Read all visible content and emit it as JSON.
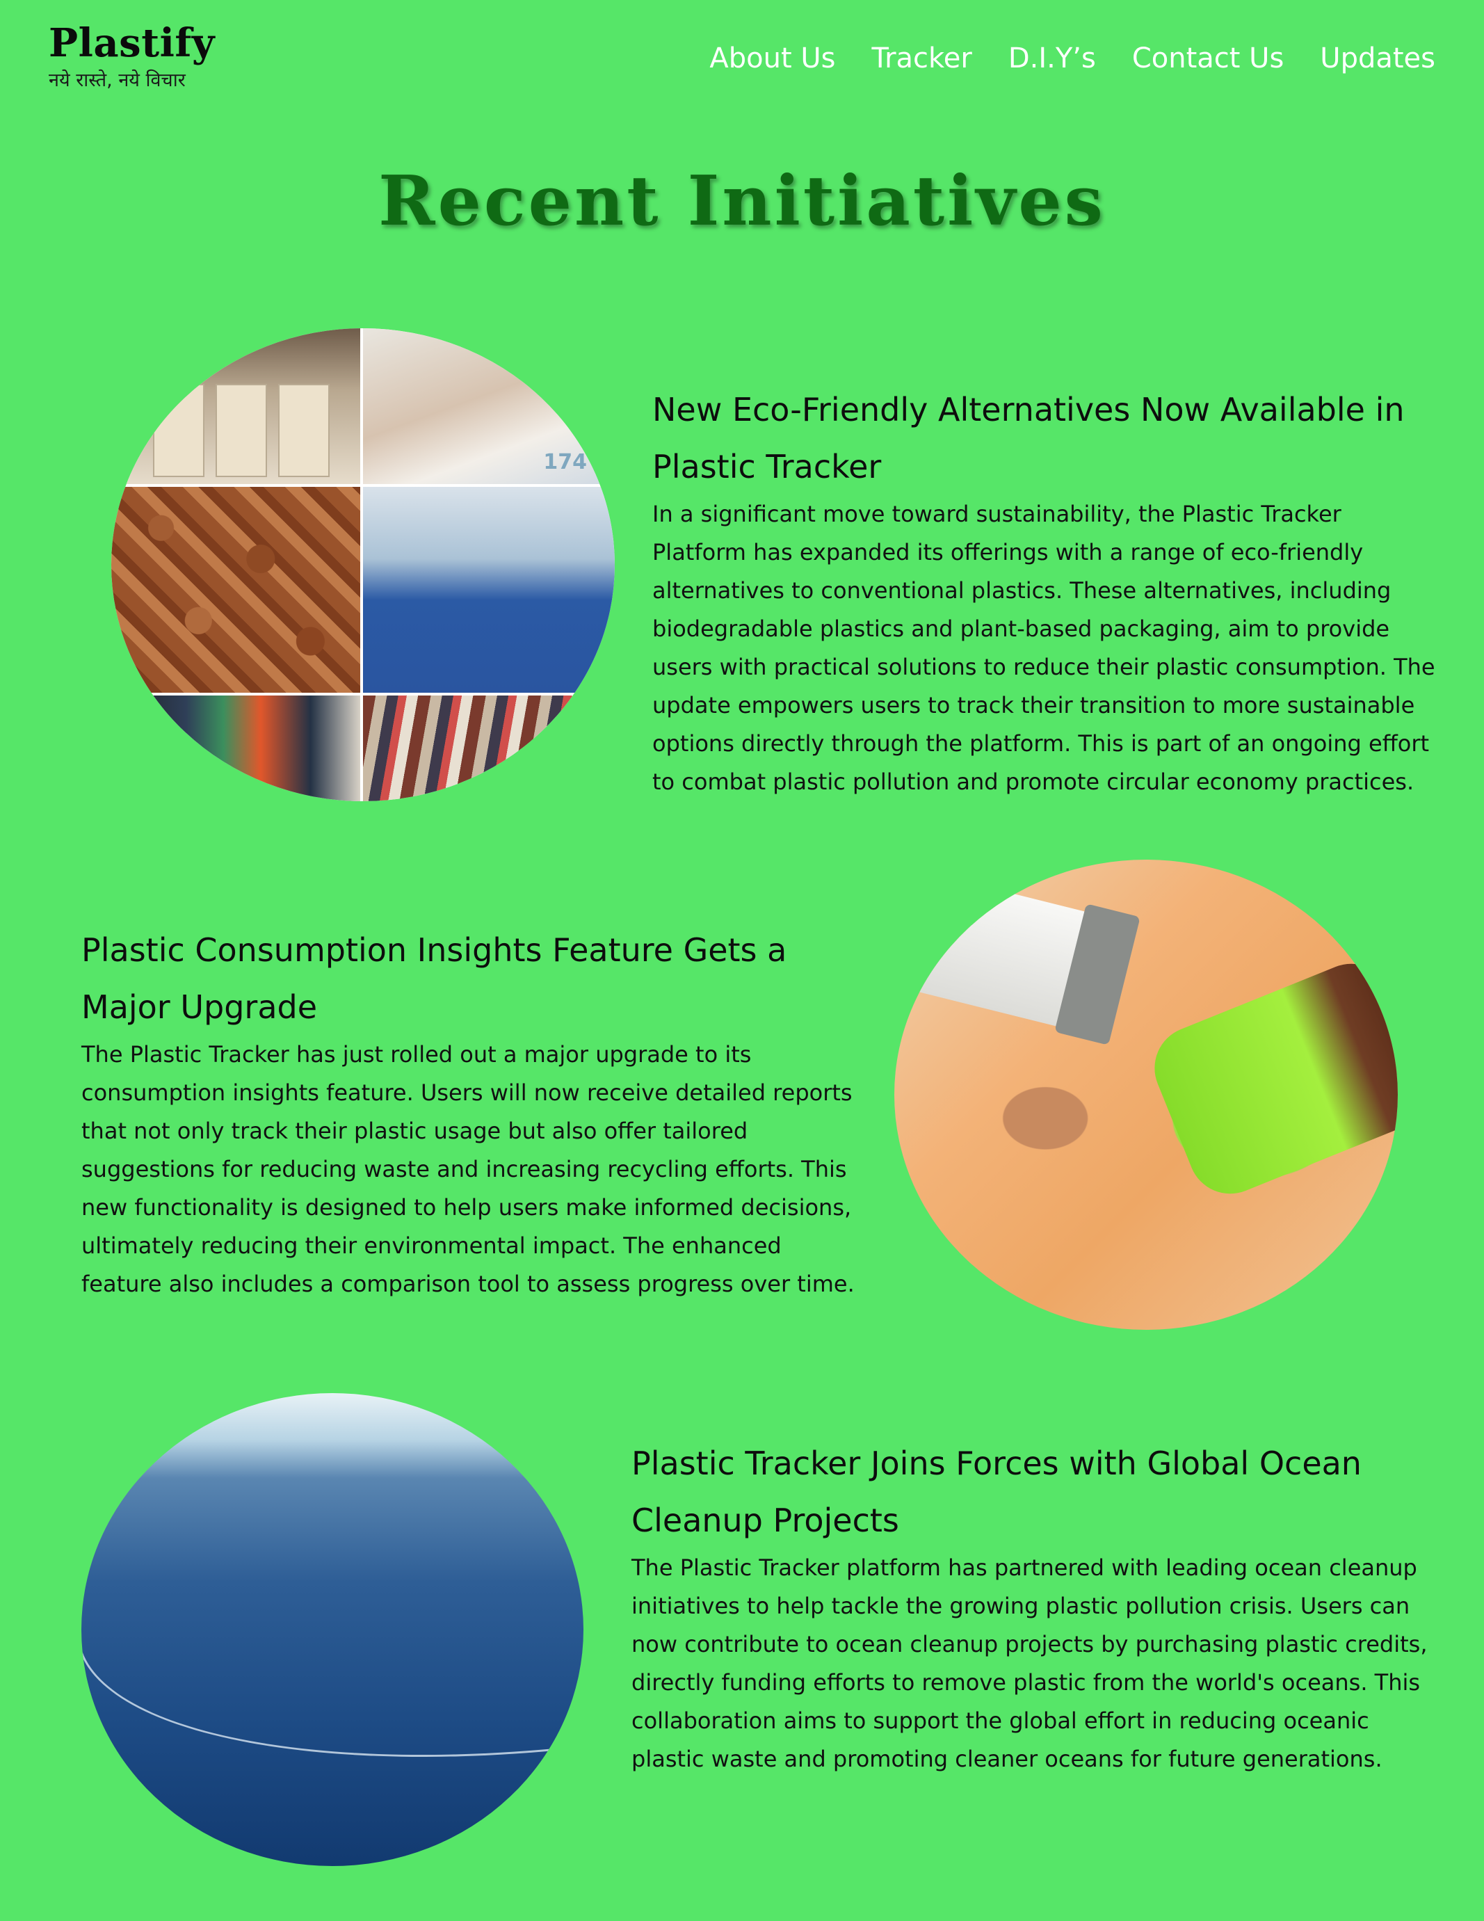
{
  "header": {
    "brand_name": "Plastify",
    "brand_tagline": "नये रास्ते, नये विचार",
    "nav": [
      {
        "label": "About Us"
      },
      {
        "label": "Tracker"
      },
      {
        "label": "D.I.Y’s"
      },
      {
        "label": "Contact Us"
      },
      {
        "label": "Updates"
      }
    ]
  },
  "main": {
    "title": "Recent Initiatives",
    "articles": [
      {
        "title": "New Eco-Friendly Alternatives Now Available in Plastic Tracker",
        "body": "In a significant move toward sustainability, the Plastic Tracker Platform has expanded its offerings with a range of eco-friendly alternatives to conventional plastics. These alternatives, including biodegradable plastics and plant-based packaging, aim to provide users with practical solutions to reduce their plastic consumption. The update empowers users to track their transition to more sustainable options directly through the platform. This is part of an ongoing effort to combat plastic pollution and promote circular economy practices.",
        "image_number": "174"
      },
      {
        "title": "Plastic Consumption Insights Feature Gets a Major Upgrade",
        "body": "The Plastic Tracker has just rolled out a major upgrade to its consumption insights feature. Users will now receive detailed reports that not only track their plastic usage but also offer tailored suggestions for reducing waste and increasing recycling efforts. This new functionality is designed to help users make informed decisions, ultimately reducing their environmental impact. The enhanced feature also includes a comparison tool to assess progress over time."
      },
      {
        "title": "Plastic Tracker Joins Forces with Global Ocean Cleanup Projects",
        "body": "The Plastic Tracker platform has partnered with leading ocean cleanup initiatives to help tackle the growing plastic pollution crisis. Users can now contribute to ocean cleanup projects by purchasing plastic credits, directly funding efforts to remove plastic from the world's oceans. This collaboration aims to support the global effort in reducing oceanic plastic waste and promoting cleaner oceans for future generations."
      }
    ]
  },
  "colors": {
    "background": "#56e668",
    "title": "#0f6a14",
    "nav_text": "#ffffff"
  }
}
